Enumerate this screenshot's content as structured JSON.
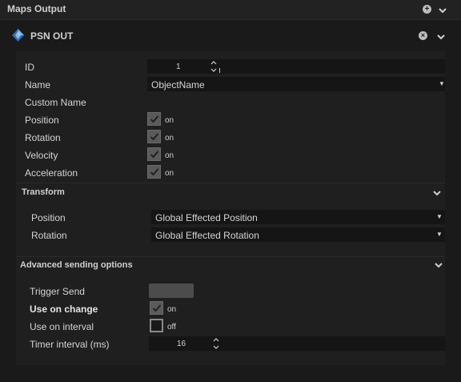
{
  "header": {
    "title": "Maps Output"
  },
  "plugin": {
    "title": "PSN OUT"
  },
  "fields": {
    "id": {
      "label": "ID",
      "value": "1"
    },
    "name": {
      "label": "Name",
      "value": "ObjectName"
    },
    "custom_name": {
      "label": "Custom Name",
      "value": ""
    },
    "position": {
      "label": "Position",
      "state": "on"
    },
    "rotation": {
      "label": "Rotation",
      "state": "on"
    },
    "velocity": {
      "label": "Velocity",
      "state": "on"
    },
    "acceleration": {
      "label": "Acceleration",
      "state": "on"
    }
  },
  "transform": {
    "title": "Transform",
    "position": {
      "label": "Position",
      "value": "Global Effected Position"
    },
    "rotation": {
      "label": "Rotation",
      "value": "Global Effected Rotation"
    }
  },
  "advanced": {
    "title": "Advanced sending options",
    "trigger_send": {
      "label": "Trigger Send"
    },
    "use_on_change": {
      "label": "Use on change",
      "state": "on"
    },
    "use_on_interval": {
      "label": "Use on interval",
      "state": "off"
    },
    "timer_interval": {
      "label": "Timer interval (ms)",
      "value": "16"
    }
  }
}
